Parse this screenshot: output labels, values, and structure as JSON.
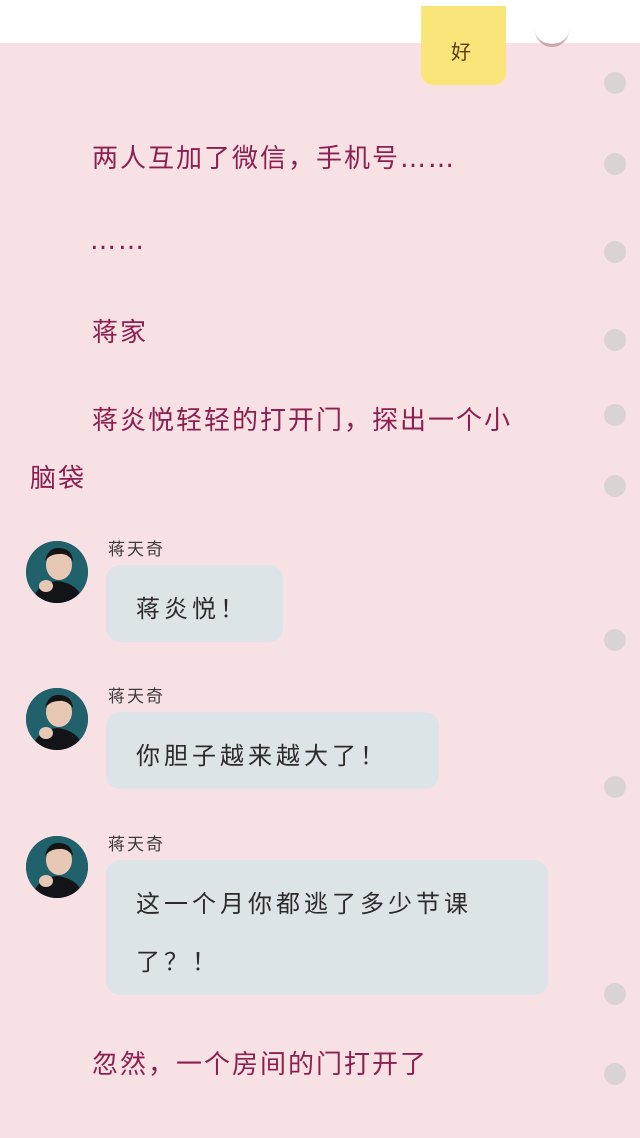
{
  "top_bubble": {
    "text": "好"
  },
  "narrations": [
    "两人互加了微信，手机号……",
    "……",
    "蒋家",
    "蒋炎悦轻轻的打开门，探出一个小",
    "脑袋",
    "忽然，一个房间的门打开了"
  ],
  "messages": [
    {
      "sender": "蒋天奇",
      "lines": [
        "蒋炎悦！"
      ]
    },
    {
      "sender": "蒋天奇",
      "lines": [
        "你胆子越来越大了！"
      ]
    },
    {
      "sender": "蒋天奇",
      "lines": [
        "这一个月你都逃了多少节课",
        "了？！"
      ]
    }
  ],
  "colors": {
    "background": "#f8e1e5",
    "narration_text": "#8c1f50",
    "bubble": "#dde4e8",
    "top_bubble": "#fae57a"
  },
  "icons": {
    "avatar": "character-avatar",
    "progress_dots": "dot-icon"
  }
}
